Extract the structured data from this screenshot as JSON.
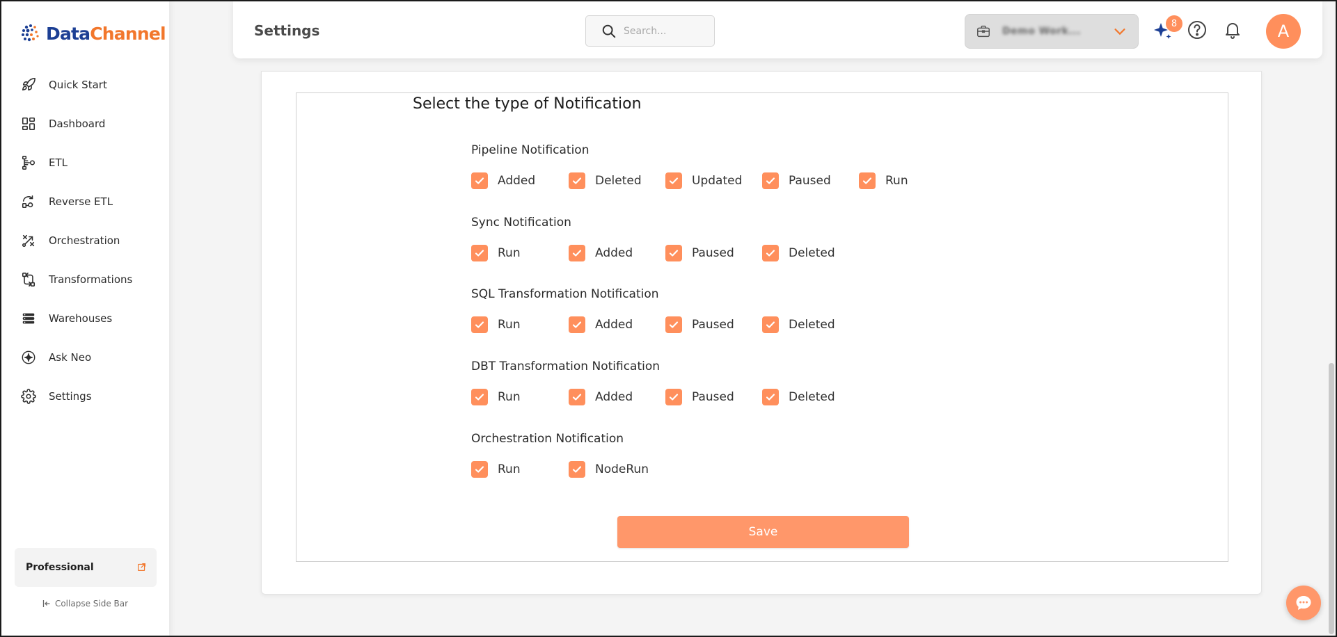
{
  "brand": {
    "name_part1": "Data",
    "name_part2": "Channel",
    "primary_color": "#1c3f94",
    "accent_color": "#f2772c"
  },
  "sidebar": {
    "items": [
      {
        "label": "Quick Start",
        "icon": "rocket-icon"
      },
      {
        "label": "Dashboard",
        "icon": "dashboard-grid-icon"
      },
      {
        "label": "ETL",
        "icon": "etl-flow-icon"
      },
      {
        "label": "Reverse ETL",
        "icon": "reverse-etl-icon"
      },
      {
        "label": "Orchestration",
        "icon": "orchestration-icon"
      },
      {
        "label": "Transformations",
        "icon": "transformations-icon"
      },
      {
        "label": "Warehouses",
        "icon": "warehouses-icon"
      },
      {
        "label": "Ask Neo",
        "icon": "sparkle-icon"
      },
      {
        "label": "Settings",
        "icon": "gear-icon"
      }
    ],
    "plan_label": "Professional",
    "collapse_label": "Collapse Side Bar"
  },
  "header": {
    "title": "Settings",
    "search_placeholder": "Search...",
    "workspace_name": "Demo Work...",
    "ai_badge_count": "8",
    "avatar_initial": "A"
  },
  "notifications": {
    "section_title": "Select the type of Notification",
    "accent_color": "#ff8f5c",
    "groups": [
      {
        "title": "Pipeline Notification",
        "options": [
          {
            "label": "Added",
            "checked": true
          },
          {
            "label": "Deleted",
            "checked": true
          },
          {
            "label": "Updated",
            "checked": true
          },
          {
            "label": "Paused",
            "checked": true
          },
          {
            "label": "Run",
            "checked": true
          }
        ]
      },
      {
        "title": "Sync Notification",
        "options": [
          {
            "label": "Run",
            "checked": true
          },
          {
            "label": "Added",
            "checked": true
          },
          {
            "label": "Paused",
            "checked": true
          },
          {
            "label": "Deleted",
            "checked": true
          }
        ]
      },
      {
        "title": "SQL Transformation Notification",
        "options": [
          {
            "label": "Run",
            "checked": true
          },
          {
            "label": "Added",
            "checked": true
          },
          {
            "label": "Paused",
            "checked": true
          },
          {
            "label": "Deleted",
            "checked": true
          }
        ]
      },
      {
        "title": "DBT Transformation Notification",
        "options": [
          {
            "label": "Run",
            "checked": true
          },
          {
            "label": "Added",
            "checked": true
          },
          {
            "label": "Paused",
            "checked": true
          },
          {
            "label": "Deleted",
            "checked": true
          }
        ]
      },
      {
        "title": "Orchestration Notification",
        "options": [
          {
            "label": "Run",
            "checked": true
          },
          {
            "label": "NodeRun",
            "checked": true
          }
        ]
      }
    ],
    "save_label": "Save"
  }
}
